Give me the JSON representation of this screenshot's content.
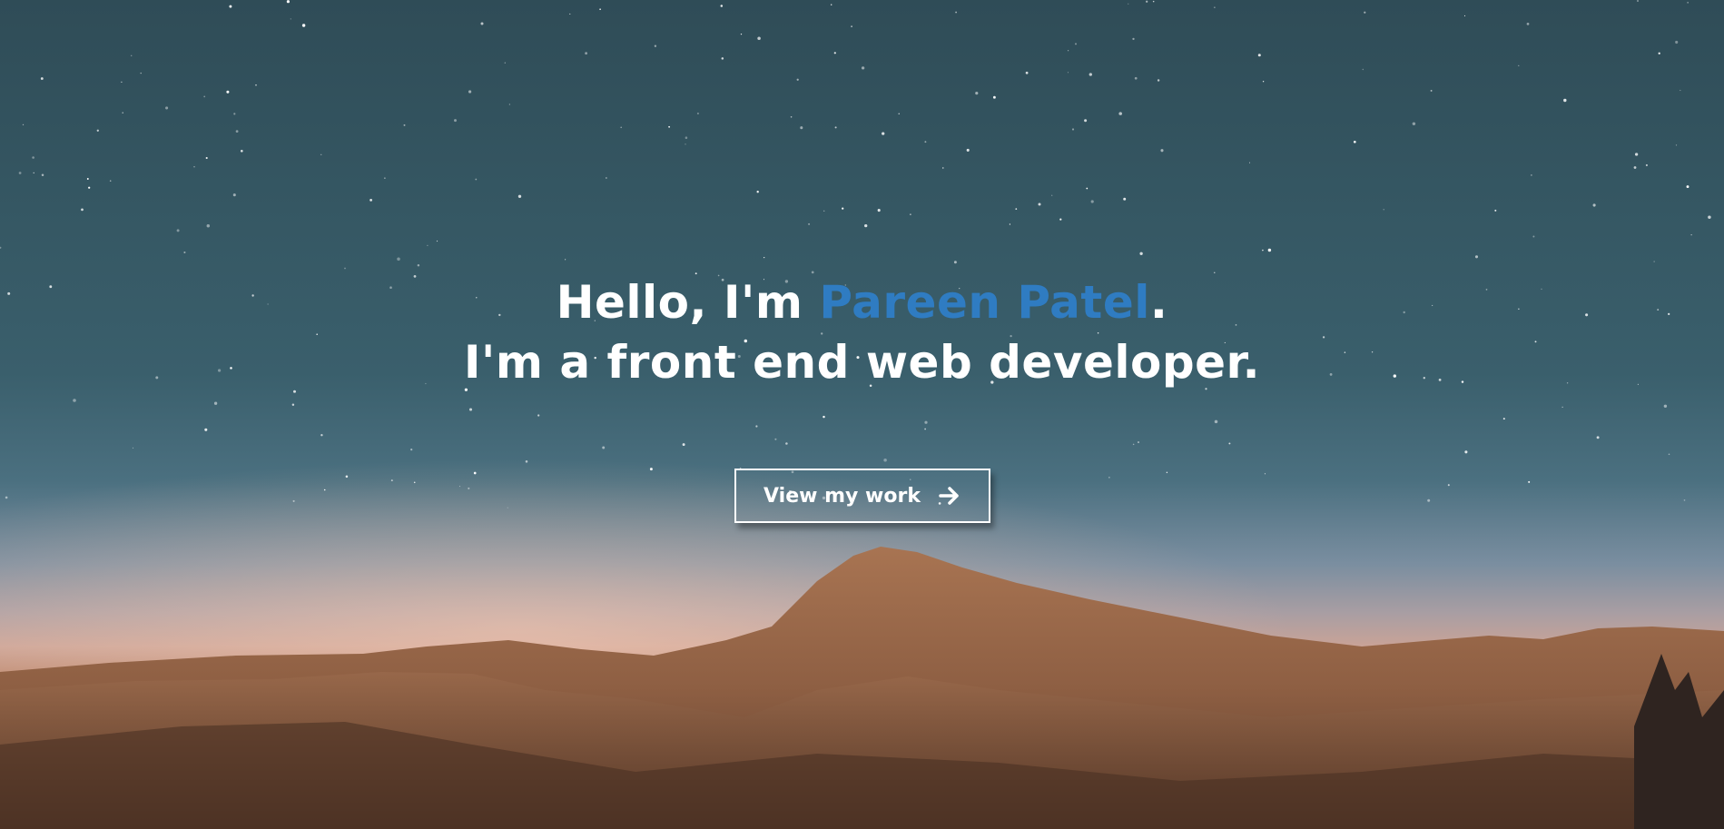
{
  "hero": {
    "greeting_prefix": "Hello, I'm ",
    "name": "Pareen Patel",
    "greeting_suffix": ".",
    "tagline": "I'm a front end web developer.",
    "cta_label": "View my work",
    "cta_icon": "arrow-right-icon"
  },
  "colors": {
    "accent": "#2f7cc2",
    "text": "#ffffff",
    "sky_top": "#2f4c57",
    "mountain": "#9a6a4c"
  }
}
